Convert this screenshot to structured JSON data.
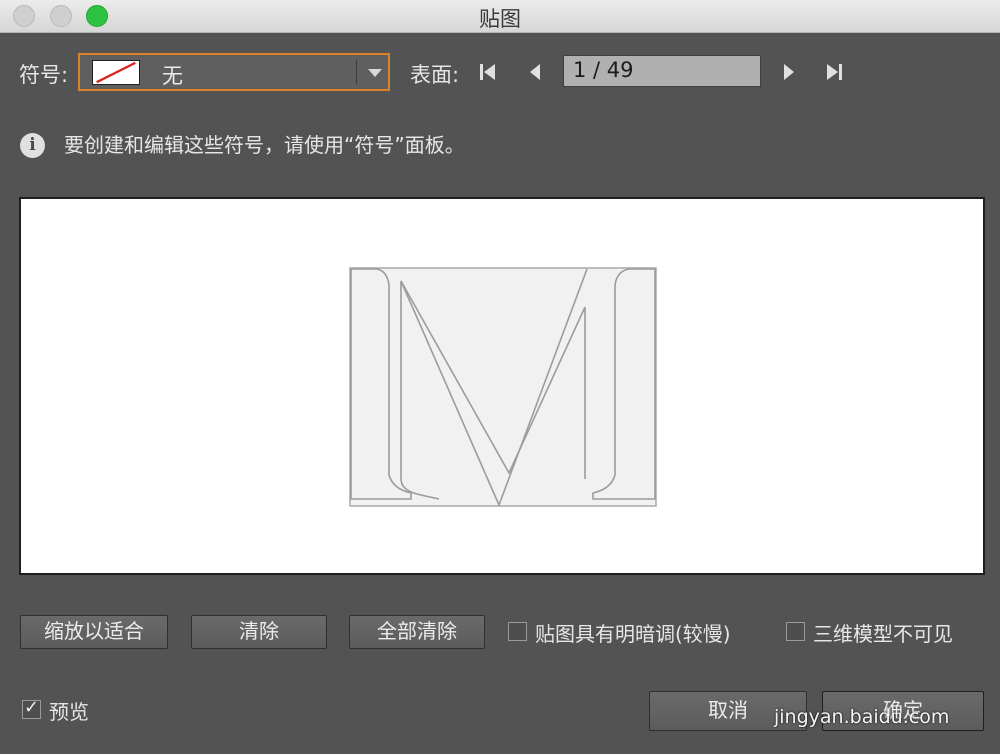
{
  "window": {
    "title": "贴图"
  },
  "symbol": {
    "label": "符号:",
    "value": "无"
  },
  "surface": {
    "label": "表面:",
    "value": "1 / 49"
  },
  "info": {
    "text": "要创建和编辑这些符号，请使用“符号”面板。"
  },
  "buttons": {
    "fit": "缩放以适合",
    "clear": "清除",
    "clear_all": "全部清除",
    "cancel": "取消",
    "ok": "确定"
  },
  "options": {
    "shade_artwork": {
      "label": "贴图具有明暗调(较慢)",
      "checked": false
    },
    "invisible_geometry": {
      "label": "三维模型不可见",
      "checked": false
    },
    "preview": {
      "label": "预览",
      "checked": true
    }
  },
  "watermark": {
    "text": "jingyan.baidu.com"
  },
  "colors": {
    "accent": "#d8822c",
    "panel": "#535353",
    "preview_bg": "#ffffff"
  }
}
